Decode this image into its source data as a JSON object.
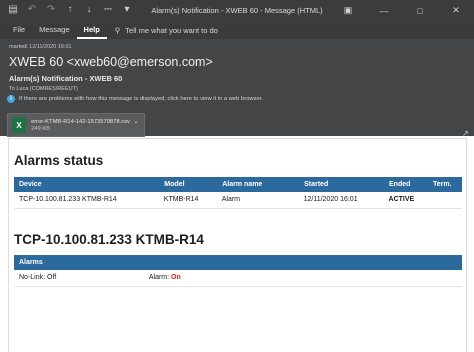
{
  "window": {
    "title": "Alarm(s) Notification - XWEB 60  -  Message (HTML)"
  },
  "ribbon": {
    "tabs": [
      "File",
      "Message",
      "Help"
    ],
    "tell_me": "Tell me what you want to do"
  },
  "message": {
    "date": "martedì 12/11/2020 16:01",
    "sender": "XWEB 60 <xweb60@emerson.com>",
    "subject": "Alarm(s) Notification - XWEB 60",
    "to_label": "To",
    "to_value": "Luca (COMRES/REEUT)",
    "info_text": "If there are problems with how this message is displayed, click here to view it in a web browser."
  },
  "attachment": {
    "name": "error-KTMB-R14-142-1573570878.csv",
    "size": "249 KB",
    "icon_letter": "X"
  },
  "alarms_status": {
    "heading": "Alarms status",
    "columns": [
      "Device",
      "Model",
      "Alarm name",
      "Started",
      "Ended",
      "Term."
    ],
    "rows": [
      {
        "device": "TCP-10.100.81.233 KTMB-R14",
        "model": "KTMB-R14",
        "alarm_name": "Alarm",
        "started": "12/11/2020 16:01",
        "ended": "ACTIVE",
        "term": ""
      }
    ]
  },
  "device_section": {
    "heading": "TCP-10.100.81.233 KTMB-R14",
    "table_header": "Alarms",
    "rows": [
      {
        "left": "No-Link: Off",
        "right_label": "Alarm: ",
        "right_value": "On"
      }
    ]
  },
  "colors": {
    "table_header": "#2c6a9e",
    "alert": "#e01b1b",
    "header_bg": "#444547",
    "titlebar_bg": "#3c3c3c"
  }
}
